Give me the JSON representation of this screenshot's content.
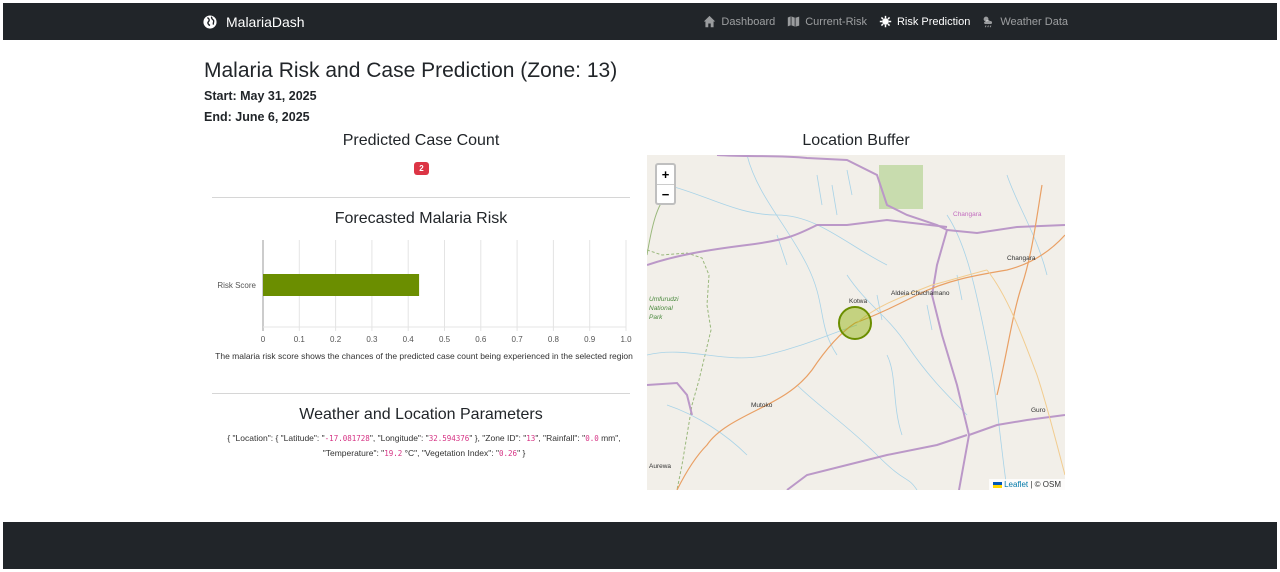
{
  "navbar": {
    "brand": "MalariaDash",
    "links": [
      {
        "label": "Dashboard",
        "icon": "home-icon"
      },
      {
        "label": "Current-Risk",
        "icon": "map-icon"
      },
      {
        "label": "Risk Prediction",
        "icon": "virus-icon",
        "active": true
      },
      {
        "label": "Weather Data",
        "icon": "cloud-sun-rain-icon"
      }
    ]
  },
  "page": {
    "title": "Malaria Risk and Case Prediction (Zone: 13)",
    "start": "Start: May 31, 2025",
    "end": "End: June 6, 2025"
  },
  "predicted": {
    "heading": "Predicted Case Count",
    "count": "2",
    "badge_color": "#dc3545"
  },
  "forecast": {
    "heading": "Forecasted Malaria Risk",
    "caption": "The malaria risk score shows the chances of the predicted case count being experienced in the selected region"
  },
  "chart_data": {
    "type": "bar",
    "orientation": "horizontal",
    "categories": [
      "Risk Score"
    ],
    "values": [
      0.43
    ],
    "xlim": [
      0,
      1.0
    ],
    "x_ticks": [
      "0",
      "0.1",
      "0.2",
      "0.3",
      "0.4",
      "0.5",
      "0.6",
      "0.7",
      "0.8",
      "0.9",
      "1.0"
    ],
    "bar_color": "#6b8e00",
    "grid": true
  },
  "params": {
    "heading": "Weather and Location Parameters",
    "t1": "{ \"Location\": { \"Latitude\": \"",
    "lat": "-17.081728",
    "t2": "\", \"Longitude\": \"",
    "lon": "32.594376",
    "t3": "\" }, \"Zone ID\": \"",
    "zone": "13",
    "t4": "\", \"Rainfall\": \"",
    "rain": "0.0",
    "t5": " mm\", \"Temperature\": \"",
    "temp": "19.2",
    "t6": " °C\", \"Vegetation Index\": \"",
    "veg": "0.26",
    "t7": "\" }"
  },
  "map": {
    "heading": "Location Buffer",
    "zoom_in": "+",
    "zoom_out": "−",
    "attribution_leaflet": "Leaflet",
    "attribution_rest": "| © OSM",
    "places": [
      "Changara",
      "Changara",
      "Kotwa",
      "Aldeia Chuchamano",
      "Umfurudzi National Park",
      "Mutoko",
      "Guro",
      "Aurewa"
    ],
    "buffer_color": "#6b8e00"
  }
}
